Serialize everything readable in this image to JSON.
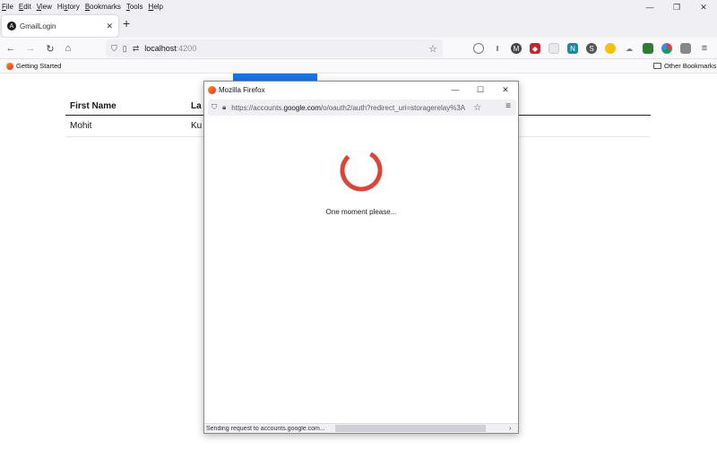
{
  "menubar": {
    "items": [
      {
        "key": "F",
        "rest": "ile"
      },
      {
        "key": "E",
        "rest": "dit"
      },
      {
        "key": "V",
        "rest": "iew"
      },
      {
        "key": "",
        "pre": "Hi",
        "keymid": "s",
        "rest": "tory"
      },
      {
        "key": "B",
        "rest": "ookmarks"
      },
      {
        "key": "T",
        "rest": "ools"
      },
      {
        "key": "H",
        "rest": "elp"
      }
    ]
  },
  "window_controls": {
    "minimize": "—",
    "restore": "❐",
    "close": "✕"
  },
  "tab": {
    "title": "GmailLogin",
    "icon_glyph": "A",
    "close": "✕",
    "new_tab": "+"
  },
  "navbar": {
    "back": "←",
    "forward": "→",
    "reload": "↻",
    "home": "⌂",
    "url_host": "localhost",
    "url_port": ":4200",
    "star": "☆",
    "menu": "≡"
  },
  "bookmarks": {
    "getting_started": "Getting Started",
    "other": "Other Bookmarks"
  },
  "page": {
    "table": {
      "headers": [
        "First Name",
        "La"
      ],
      "rows": [
        [
          "Mohit",
          "Ku"
        ]
      ]
    }
  },
  "popup": {
    "title": "Mozilla Firefox",
    "url_prefix": "https://accounts.",
    "url_domain": "google.com",
    "url_suffix": "/o/oauth2/auth?redirect_uri=storagerelay%3A",
    "loading_text": "One moment please...",
    "status_text": "Sending request to accounts.google.com...",
    "spinner_color": "#db4437",
    "controls": {
      "minimize": "—",
      "maximize": "☐",
      "close": "✕"
    },
    "star": "☆",
    "menu": "≡",
    "scroll_arrow": "›"
  },
  "colors": {
    "accent": "#1a73e8",
    "spinner": "#db4437"
  }
}
